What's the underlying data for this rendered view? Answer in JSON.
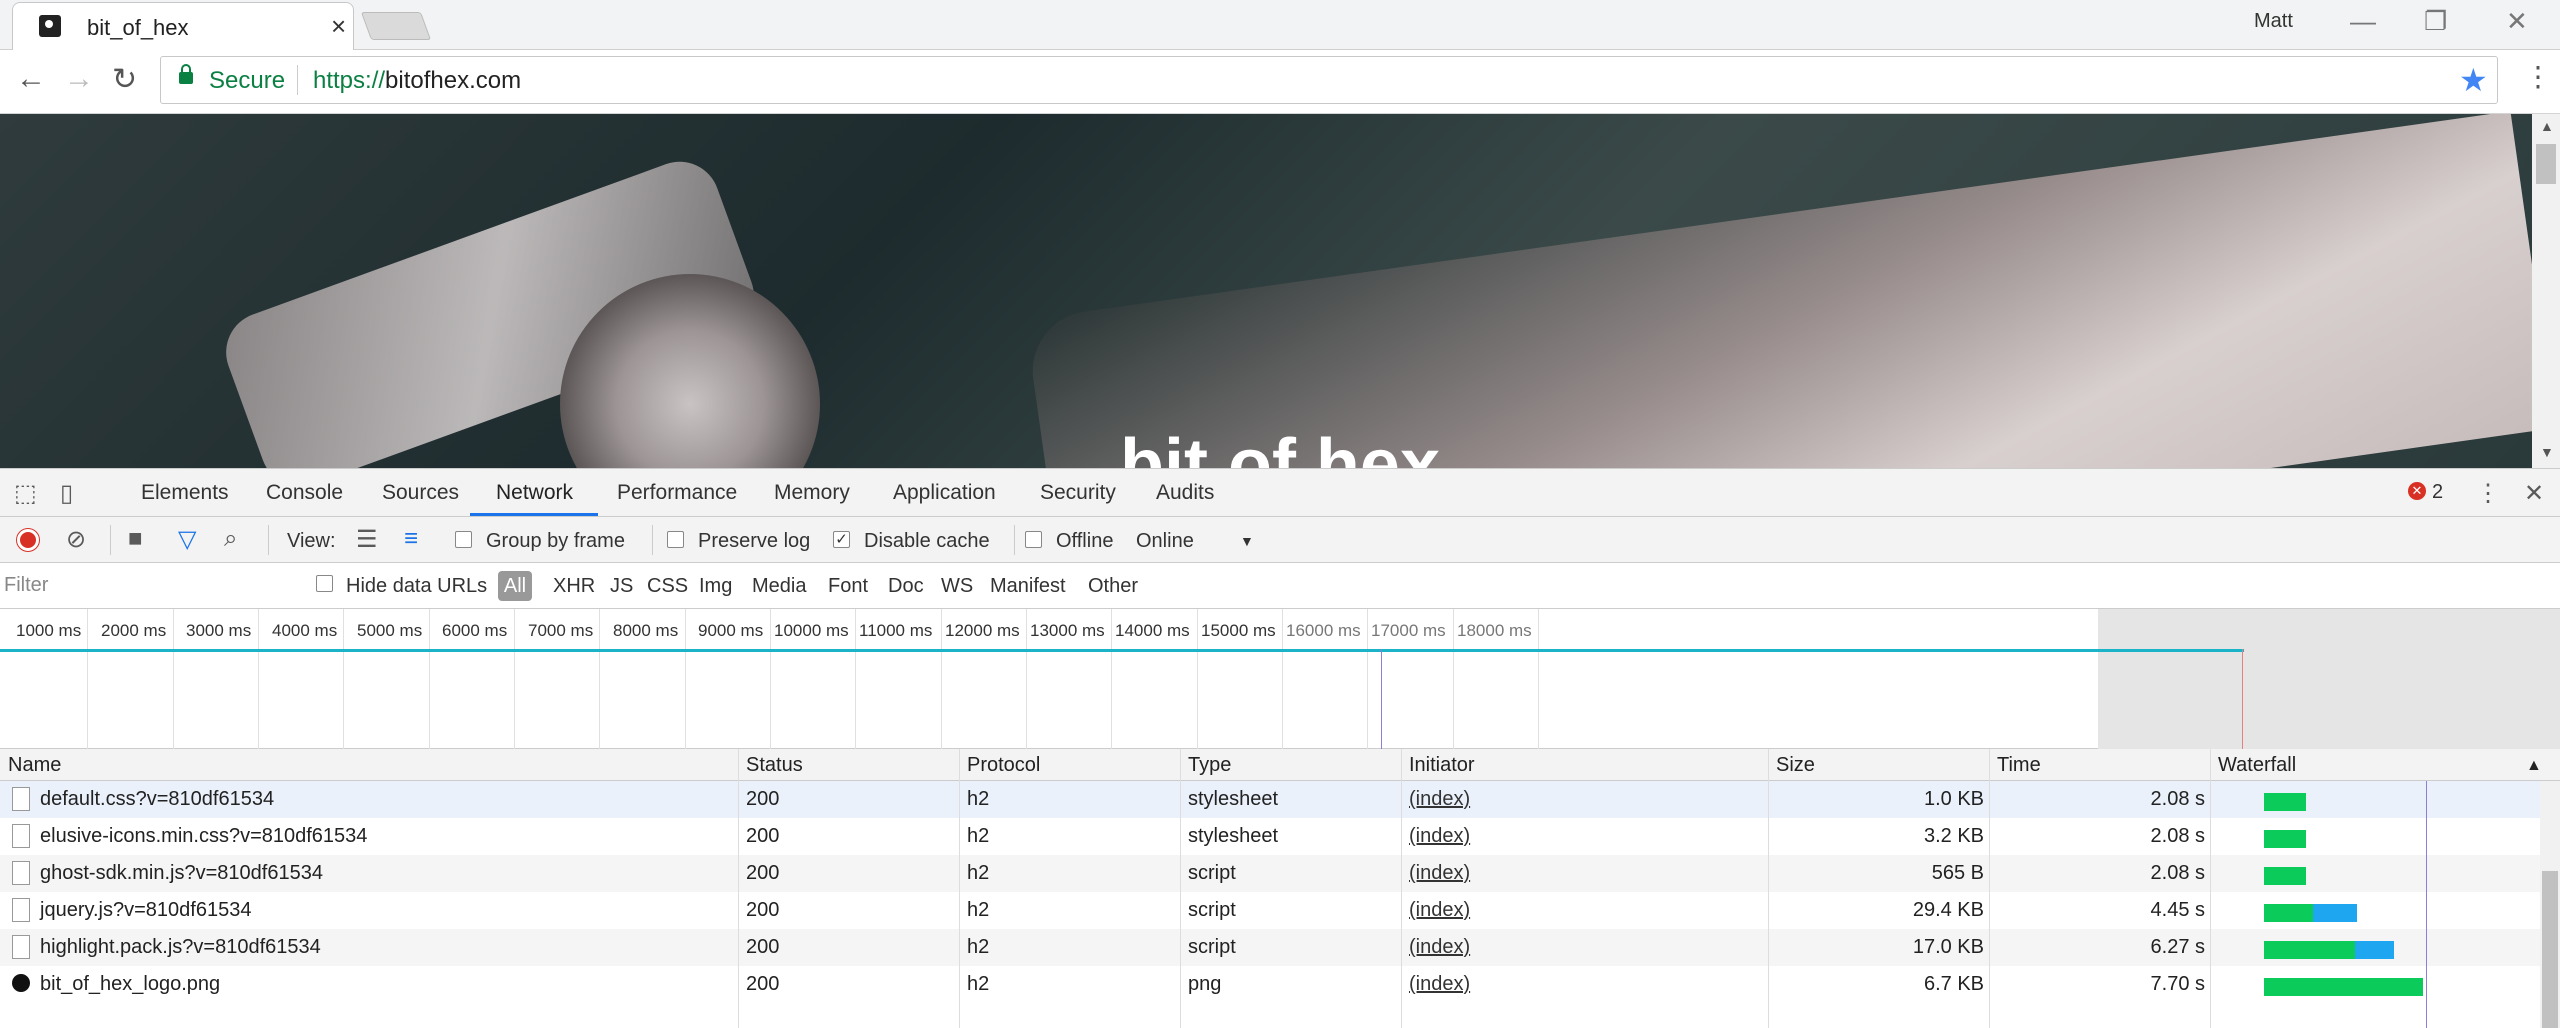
{
  "browser": {
    "tab_title": "bit_of_hex",
    "tab_close": "×",
    "profile": "Matt",
    "window_buttons": {
      "minimize": "—",
      "restore": "❐",
      "close": "✕"
    },
    "nav": {
      "back": "←",
      "forward": "→",
      "reload": "↻"
    },
    "security_label": "Secure",
    "url_protocol": "https://",
    "url_host": "bitofhex.com",
    "bookmark_star": "★",
    "menu": "⋮"
  },
  "page": {
    "hero_title": "bit of hex"
  },
  "devtools": {
    "tabs": [
      "Elements",
      "Console",
      "Sources",
      "Network",
      "Performance",
      "Memory",
      "Application",
      "Security",
      "Audits"
    ],
    "active_tab": "Network",
    "error_count": "2",
    "error_icon": "✕",
    "menu": "⋮",
    "close": "✕",
    "toolbar": {
      "view_label": "View:",
      "group_by_frame": "Group by frame",
      "preserve_log": "Preserve log",
      "disable_cache": "Disable cache",
      "disable_cache_checked": true,
      "offline": "Offline",
      "throttling": "Online",
      "dropdown_arrow": "▼"
    },
    "filter": {
      "placeholder": "Filter",
      "hide_data_urls": "Hide data URLs",
      "types": [
        "All",
        "XHR",
        "JS",
        "CSS",
        "Img",
        "Media",
        "Font",
        "Doc",
        "WS",
        "Manifest",
        "Other"
      ],
      "active_type": "All"
    },
    "timeline_labels": [
      "1000 ms",
      "2000 ms",
      "3000 ms",
      "4000 ms",
      "5000 ms",
      "6000 ms",
      "7000 ms",
      "8000 ms",
      "9000 ms",
      "10000 ms",
      "11000 ms",
      "12000 ms",
      "13000 ms",
      "14000 ms",
      "15000 ms",
      "16000 ms",
      "17000 ms",
      "18000 ms"
    ],
    "table": {
      "columns": [
        "Name",
        "Status",
        "Protocol",
        "Type",
        "Initiator",
        "Size",
        "Time",
        "Waterfall"
      ],
      "sort_arrow": "▲",
      "rows": [
        {
          "name": "default.css?v=810df61534",
          "status": "200",
          "protocol": "h2",
          "type": "stylesheet",
          "initiator": "(index)",
          "size": "1.0 KB",
          "time": "2.08 s",
          "icon": "file-icon",
          "wf_wait": 0.26,
          "wf_download": 0
        },
        {
          "name": "elusive-icons.min.css?v=810df61534",
          "status": "200",
          "protocol": "h2",
          "type": "stylesheet",
          "initiator": "(index)",
          "size": "3.2 KB",
          "time": "2.08 s",
          "icon": "file-icon",
          "wf_wait": 0.26,
          "wf_download": 0
        },
        {
          "name": "ghost-sdk.min.js?v=810df61534",
          "status": "200",
          "protocol": "h2",
          "type": "script",
          "initiator": "(index)",
          "size": "565 B",
          "time": "2.08 s",
          "icon": "file-icon",
          "wf_wait": 0.26,
          "wf_download": 0
        },
        {
          "name": "jquery.js?v=810df61534",
          "status": "200",
          "protocol": "h2",
          "type": "script",
          "initiator": "(index)",
          "size": "29.4 KB",
          "time": "4.45 s",
          "icon": "file-icon",
          "wf_wait": 0.3,
          "wf_download": 0.27
        },
        {
          "name": "highlight.pack.js?v=810df61534",
          "status": "200",
          "protocol": "h2",
          "type": "script",
          "initiator": "(index)",
          "size": "17.0 KB",
          "time": "6.27 s",
          "icon": "file-icon",
          "wf_wait": 0.56,
          "wf_download": 0.24
        },
        {
          "name": "bit_of_hex_logo.png",
          "status": "200",
          "protocol": "h2",
          "type": "png",
          "initiator": "(index)",
          "size": "6.7 KB",
          "time": "7.70 s",
          "icon": "image-icon",
          "wf_wait": 0.98,
          "wf_download": 0
        }
      ]
    },
    "colors": {
      "wait": "#0bcc5a",
      "download": "#1ea7f0",
      "selected_row": "#eaf1fb",
      "alt_row": "#f5f5f5"
    }
  }
}
